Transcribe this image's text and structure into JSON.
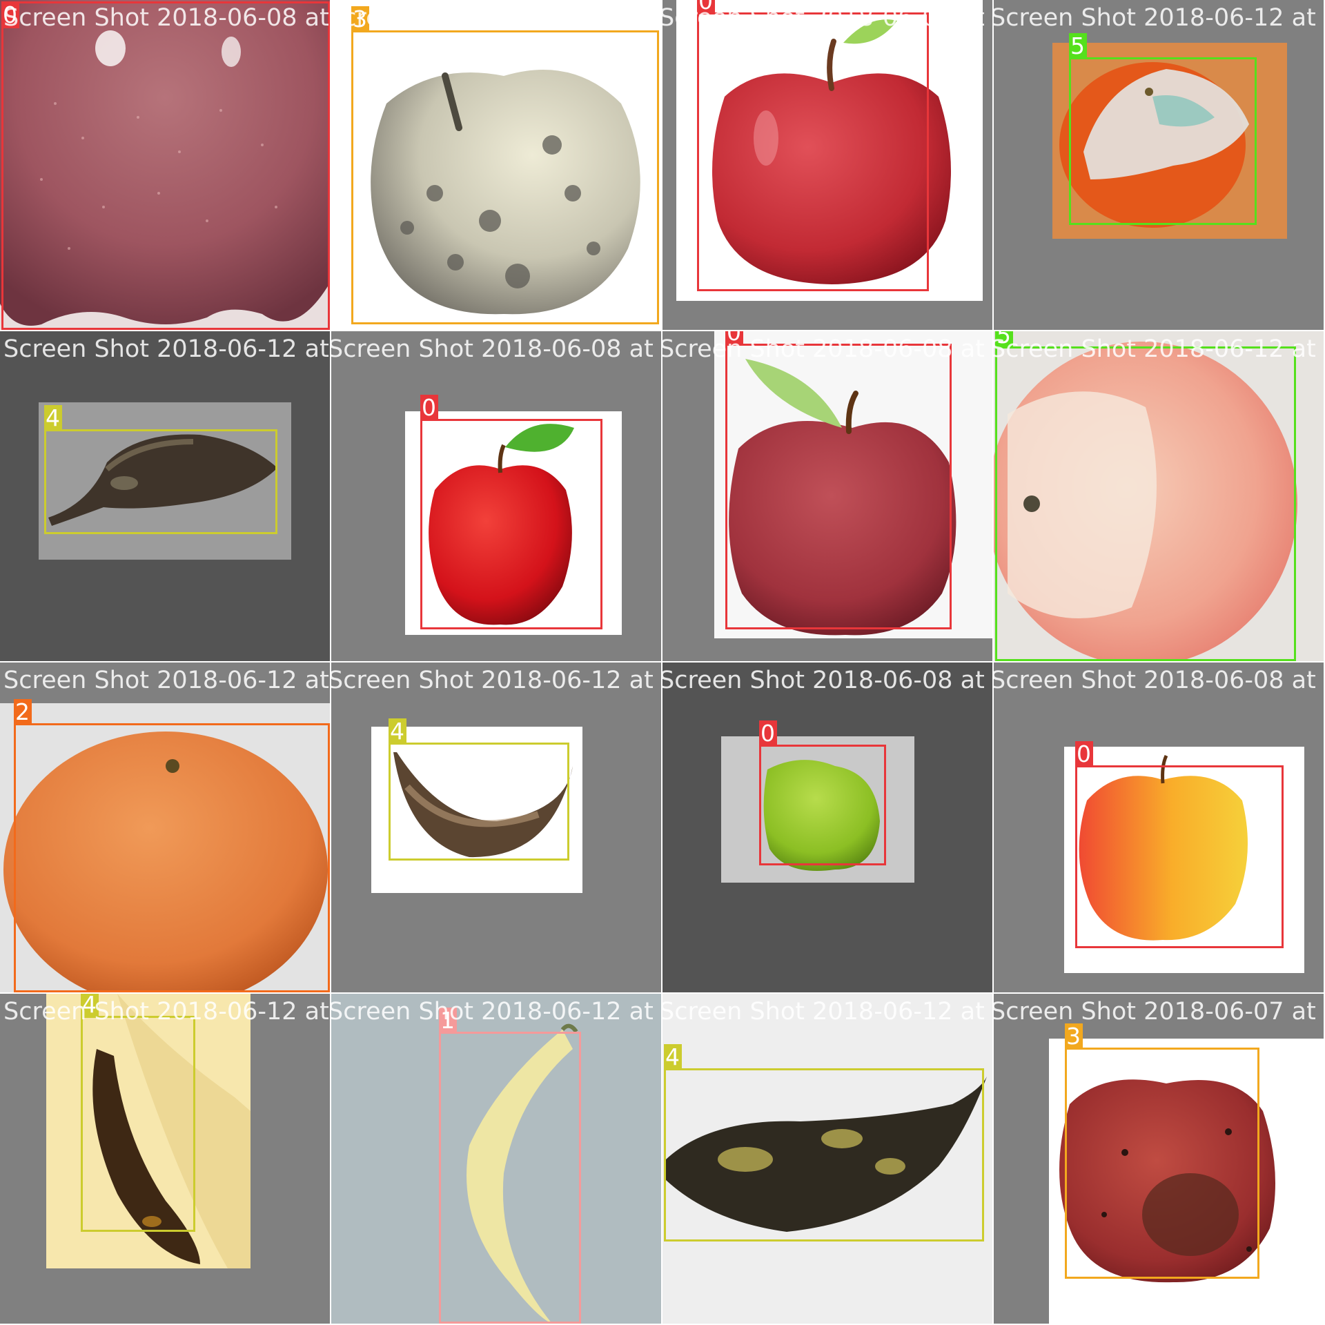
{
  "class_colors": {
    "0": "#e8363a",
    "1": "#f59a9a",
    "2": "#f26a1b",
    "3": "#f2a81e",
    "4": "#cccc2e",
    "5": "#55e01c"
  },
  "tiles": [
    {
      "filename": "Screen Shot 2018-06-08 at 5:24:58 PM.png",
      "subject": "red-apple-closeup",
      "labels": [
        {
          "cls": "0"
        }
      ]
    },
    {
      "filename": "Screen Shot 2018-06-08 at 2:41:16 PM.png",
      "subject": "rotten-pale-apple",
      "labels": [
        {
          "cls": "3"
        }
      ]
    },
    {
      "filename": "Screen Shot 2018-06-08 at 5:09:03 PM.png",
      "subject": "fresh-red-apple",
      "labels": [
        {
          "cls": "0"
        }
      ]
    },
    {
      "filename": "Screen Shot 2018-06-12 at 9:07:08 PM.png",
      "subject": "moldy-orange",
      "labels": [
        {
          "cls": "5"
        }
      ]
    },
    {
      "filename": "Screen Shot 2018-06-12 at 9:07:08 PM.png",
      "subject": "rotten-banana",
      "labels": [
        {
          "cls": "4"
        }
      ]
    },
    {
      "filename": "Screen Shot 2018-06-08 at 4:59:45 PM.png",
      "subject": "fresh-red-apple-leaf",
      "labels": [
        {
          "cls": "0"
        }
      ]
    },
    {
      "filename": "Screen Shot 2018-06-08 at 5:07:32 PM.png",
      "subject": "red-apple-with-leaf",
      "labels": [
        {
          "cls": "0"
        }
      ]
    },
    {
      "filename": "Screen Shot 2018-06-12 at 11:58:18 PM.png",
      "subject": "moldy-orange-closeup",
      "labels": [
        {
          "cls": "5"
        }
      ]
    },
    {
      "filename": "Screen Shot 2018-06-12 at 11:58:18 PM.png",
      "subject": "fresh-orange",
      "labels": [
        {
          "cls": "2"
        }
      ]
    },
    {
      "filename": "Screen Shot 2018-06-12 at 9:22:25 PM.png",
      "subject": "rotten-banana",
      "labels": [
        {
          "cls": "4"
        }
      ]
    },
    {
      "filename": "Screen Shot 2018-06-08 at 5:06:19 PM.png",
      "subject": "green-apple",
      "labels": [
        {
          "cls": "0"
        }
      ]
    },
    {
      "filename": "Screen Shot 2018-06-08 at 5:06:19 PM.png",
      "subject": "yellow-red-apple",
      "labels": [
        {
          "cls": "0"
        }
      ]
    },
    {
      "filename": "Screen Shot 2018-06-12 at 9:20:31 PM.png",
      "subject": "rotten-banana",
      "labels": [
        {
          "cls": "4"
        }
      ]
    },
    {
      "filename": "Screen Shot 2018-06-12 at 9:46:55 PM.png",
      "subject": "fresh-banana",
      "labels": [
        {
          "cls": "1"
        }
      ]
    },
    {
      "filename": "Screen Shot 2018-06-12 at 9:25:34 PM.png",
      "subject": "rotten-banana",
      "labels": [
        {
          "cls": "4"
        }
      ]
    },
    {
      "filename": "Screen Shot 2018-06-07 at 2:53:43 PM.png",
      "subject": "rotten-red-apple",
      "labels": [
        {
          "cls": "3"
        }
      ]
    }
  ]
}
